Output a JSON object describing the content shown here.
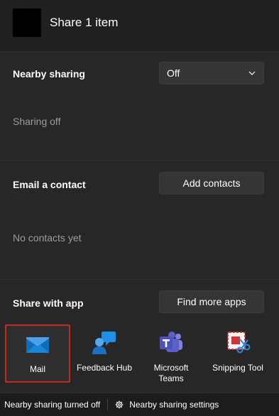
{
  "header": {
    "title": "Share 1 item"
  },
  "nearby": {
    "label": "Nearby sharing",
    "value": "Off",
    "status": "Sharing off"
  },
  "email": {
    "label": "Email a contact",
    "button": "Add contacts",
    "empty": "No contacts yet"
  },
  "apps_section": {
    "label": "Share with app",
    "button": "Find more apps"
  },
  "apps": [
    {
      "name": "Mail",
      "icon": "mail-icon"
    },
    {
      "name": "Feedback Hub",
      "icon": "feedback-hub-icon"
    },
    {
      "name": "Microsoft\nTeams",
      "icon": "teams-icon"
    },
    {
      "name": "Snipping Tool",
      "icon": "snipping-tool-icon"
    }
  ],
  "statusbar": {
    "left": "Nearby sharing turned off",
    "right": "Nearby sharing settings"
  },
  "colors": {
    "background": "#202020",
    "panel": "#272727",
    "selection": "#c42b1c",
    "mail_blue": "#0f6cbd",
    "teams_purple": "#5b5fc7"
  }
}
